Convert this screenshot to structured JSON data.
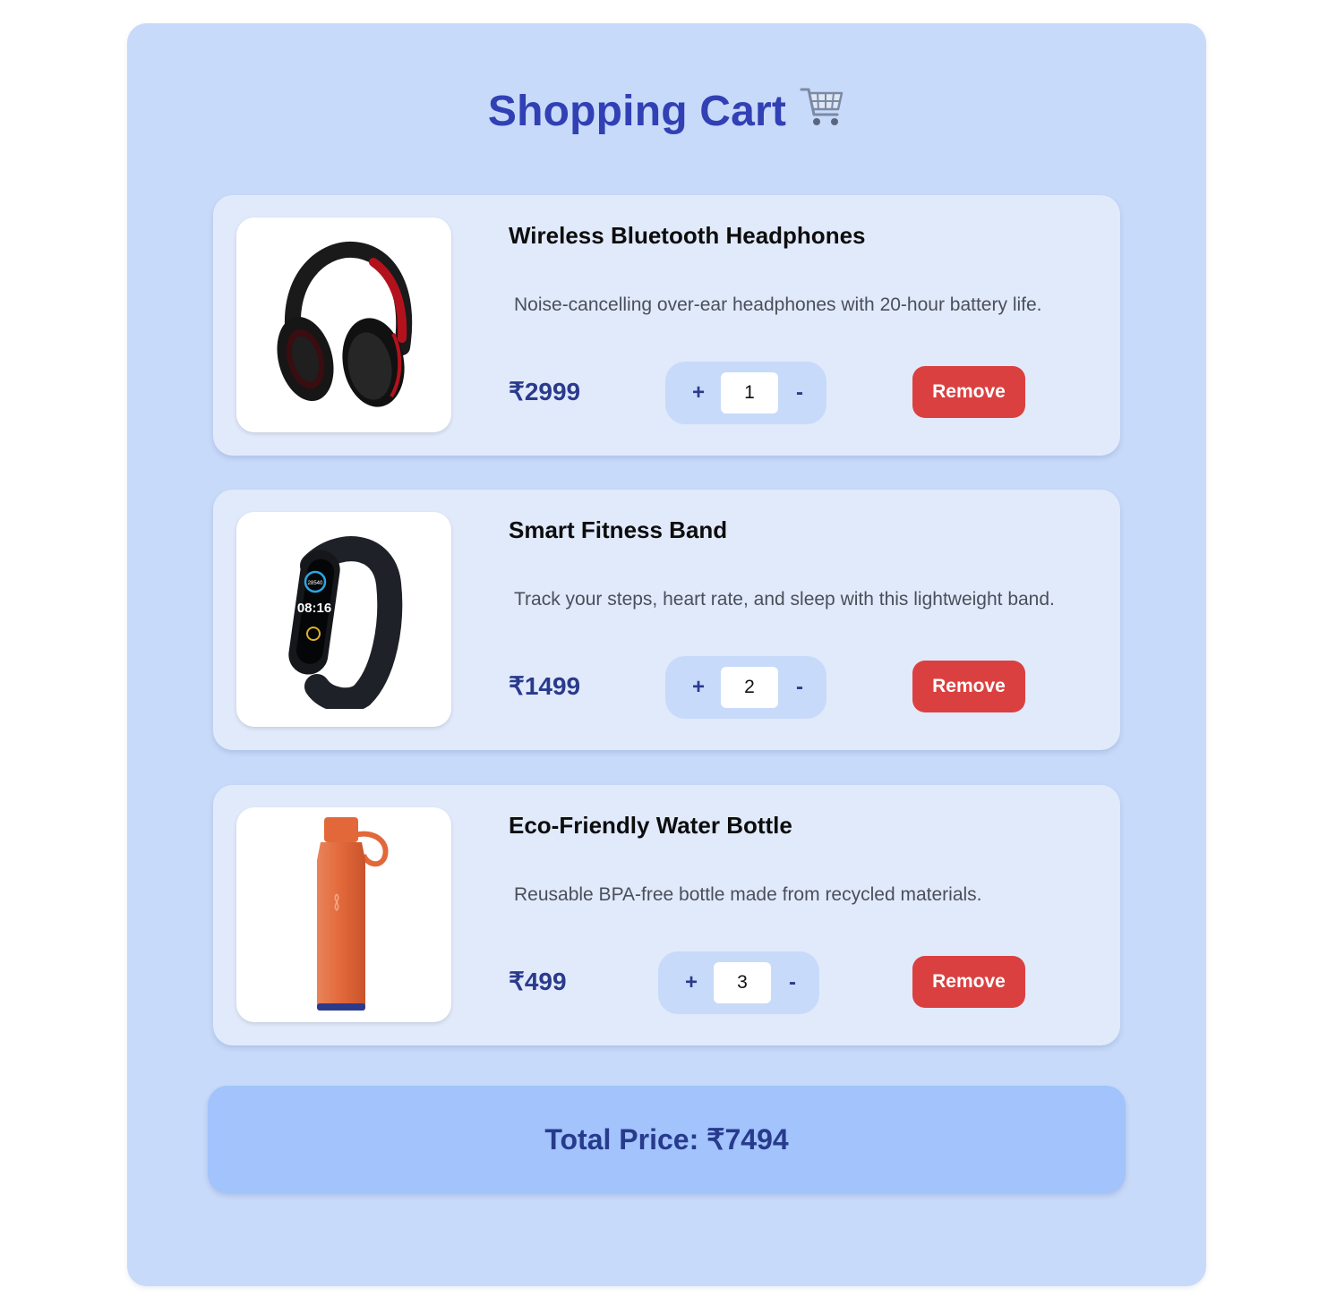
{
  "header": {
    "title": "Shopping Cart",
    "title_emoji": "🛒"
  },
  "items": [
    {
      "name": "Wireless Bluetooth Headphones",
      "description": "Noise-cancelling over-ear headphones with 20-hour battery life.",
      "price": "₹2999",
      "quantity": "1",
      "plus_label": "+",
      "minus_label": "-",
      "remove_label": "Remove",
      "image_icon": "headphones-image"
    },
    {
      "name": "Smart Fitness Band",
      "description": "Track your steps, heart rate, and sleep with this lightweight band.",
      "price": "₹1499",
      "quantity": "2",
      "plus_label": "+",
      "minus_label": "-",
      "remove_label": "Remove",
      "image_icon": "fitness-band-image",
      "screen_top": "28540",
      "screen_time": "08:16"
    },
    {
      "name": "Eco-Friendly Water Bottle",
      "description": "Reusable BPA-free bottle made from recycled materials.",
      "price": "₹499",
      "quantity": "3",
      "plus_label": "+",
      "minus_label": "-",
      "remove_label": "Remove",
      "image_icon": "water-bottle-image"
    }
  ],
  "summary": {
    "total_label": "Total Price:",
    "total_value": "₹7494"
  },
  "colors": {
    "card_bg": "#c8daf9",
    "item_bg": "#e1eafb",
    "title": "#3140b4",
    "price": "#2a3a8c",
    "remove": "#db4040",
    "total_bg": "#a2c3fb"
  }
}
